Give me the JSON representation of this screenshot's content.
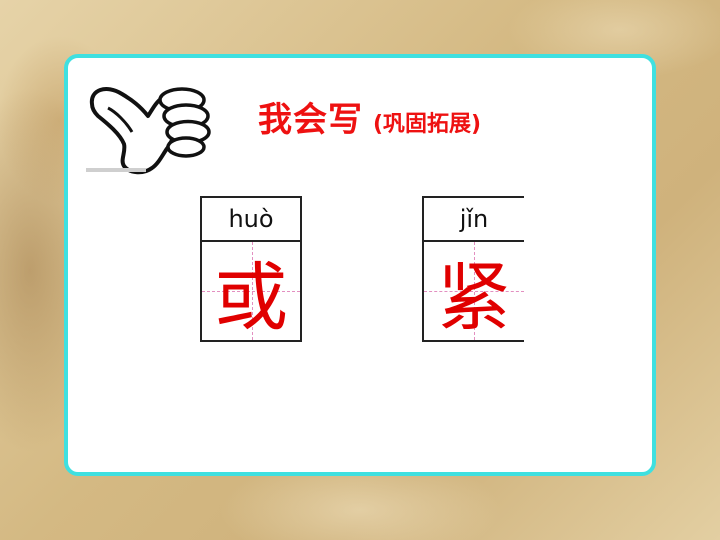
{
  "slide": {
    "title_main": "我会写",
    "title_sub": "(巩固拓展)"
  },
  "characters": [
    {
      "pinyin": "huò",
      "hanzi": "或"
    },
    {
      "pinyin": "jǐn",
      "hanzi": "紧"
    }
  ],
  "colors": {
    "title": "#ee1111",
    "hanzi": "#e00000",
    "card_border": "#3fe0e0",
    "guide_lines": "#e38fc0"
  },
  "icons": {
    "thumb": "thumbs-up-icon"
  }
}
